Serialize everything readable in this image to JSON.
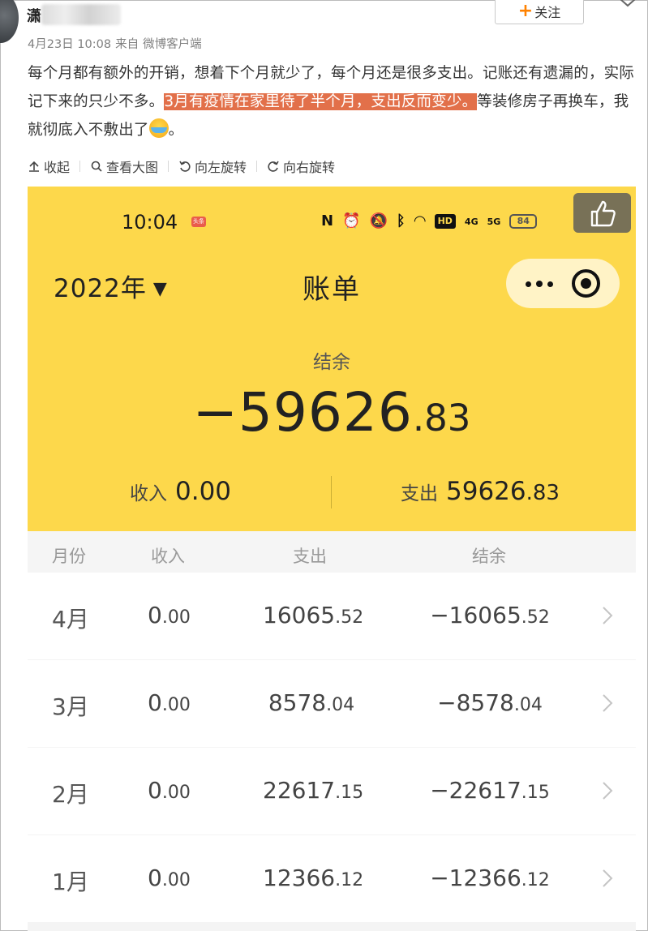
{
  "post": {
    "username": "潇",
    "date": "4月23日 10:08",
    "source_prefix": "来自",
    "source": "微博客户端",
    "follow_label": "关注",
    "text_before": "每个月都有额外的开销，想着下个月就少了，每个月还是很多支出。记账还有遗漏的，实际记下来的只少不多。",
    "text_highlight": "3月有疫情在家里待了半个月，支出反而变少。",
    "text_after": "等装修房子再换车，我就彻底入不敷出了",
    "text_end": "。"
  },
  "toolbar": {
    "collapse": "收起",
    "view_large": "查看大图",
    "rotate_left": "向左旋转",
    "rotate_right": "向右旋转"
  },
  "phone": {
    "time": "10:04",
    "badge": "头条",
    "status_icons": [
      "nfc-icon",
      "alarm-icon",
      "mute-icon",
      "bluetooth-icon",
      "wifi-icon",
      "hd-icon",
      "4g-signal-icon",
      "5g-signal-icon",
      "battery-icon"
    ],
    "hd": "HD",
    "net_4g": "4G",
    "net_5g": "5G",
    "battery": "84",
    "year": "2022年",
    "title": "账单",
    "balance_label": "结余",
    "balance_int": "−59626",
    "balance_dec": ".83",
    "income_label": "收入",
    "income_value": "0.00",
    "expense_label": "支出",
    "expense_int": "59626",
    "expense_dec": ".83",
    "columns": [
      "月份",
      "收入",
      "支出",
      "结余"
    ],
    "rows": [
      {
        "month": "4月",
        "income_int": "0",
        "income_dec": ".00",
        "expense_int": "16065",
        "expense_dec": ".52",
        "balance_int": "−16065",
        "balance_dec": ".52"
      },
      {
        "month": "3月",
        "income_int": "0",
        "income_dec": ".00",
        "expense_int": "8578",
        "expense_dec": ".04",
        "balance_int": "−8578",
        "balance_dec": ".04"
      },
      {
        "month": "2月",
        "income_int": "0",
        "income_dec": ".00",
        "expense_int": "22617",
        "expense_dec": ".15",
        "balance_int": "−22617",
        "balance_dec": ".15"
      },
      {
        "month": "1月",
        "income_int": "0",
        "income_dec": ".00",
        "expense_int": "12366",
        "expense_dec": ".12",
        "balance_int": "−12366",
        "balance_dec": ".12"
      }
    ]
  },
  "colors": {
    "accent_yellow": "#fdd84b",
    "highlight": "#e2704a",
    "follow_plus": "#ff8200"
  }
}
